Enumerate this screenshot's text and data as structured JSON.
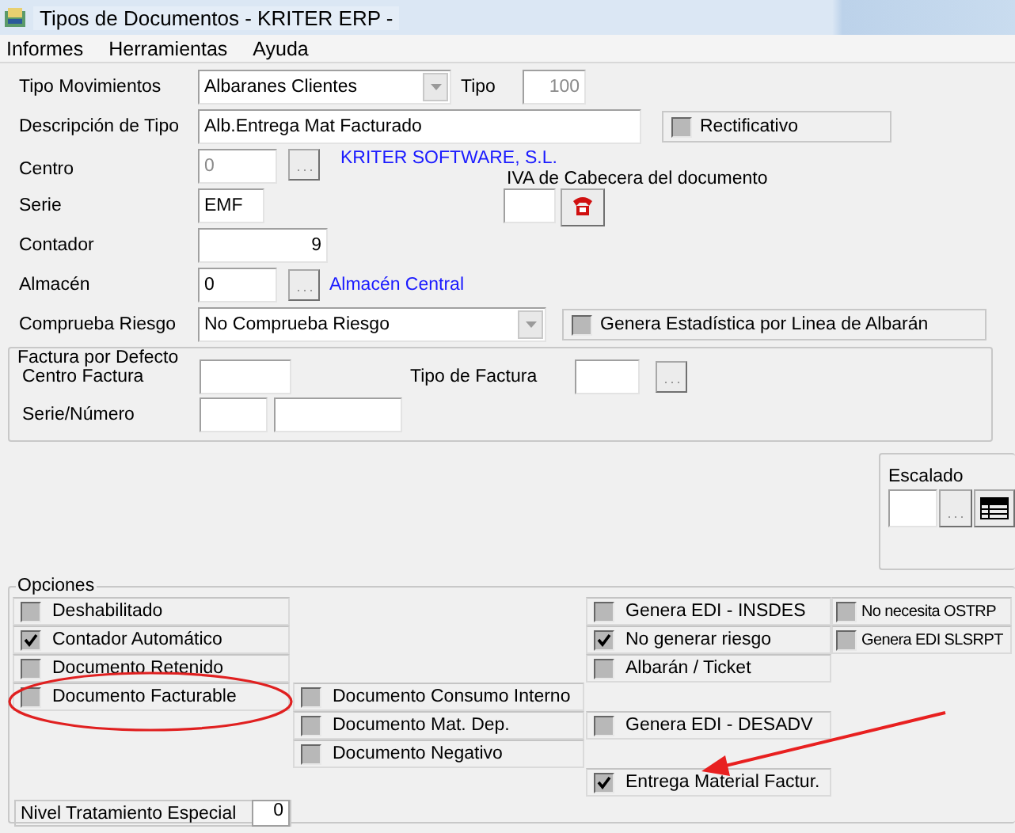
{
  "window": {
    "title": "Tipos de Documentos - KRITER ERP -"
  },
  "menu": [
    "Informes",
    "Herramientas",
    "Ayuda"
  ],
  "form": {
    "tipo_movimientos": {
      "label": "Tipo Movimientos",
      "value": "Albaranes Clientes"
    },
    "tipo": {
      "label": "Tipo",
      "value": "100",
      "disabled": true
    },
    "descripcion": {
      "label": "Descripción de Tipo",
      "value": "Alb.Entrega Mat Facturado"
    },
    "rectificativo": {
      "label": "Rectificativo",
      "checked": false
    },
    "centro": {
      "label": "Centro",
      "value": "0",
      "disabled": true,
      "name": "KRITER SOFTWARE, S.L."
    },
    "iva": {
      "label": "IVA de Cabecera del documento"
    },
    "serie": {
      "label": "Serie",
      "value": "EMF"
    },
    "contador": {
      "label": "Contador",
      "value": "9"
    },
    "almacen": {
      "label": "Almacén",
      "value": "0",
      "disabled": false,
      "name": "Almacén Central"
    },
    "comprueba_riesgo": {
      "label": "Comprueba Riesgo",
      "value": "No Comprueba Riesgo"
    },
    "genera_estadistica": {
      "label": "Genera Estadística por Linea de Albarán",
      "checked": false
    }
  },
  "factura_por_defecto": {
    "title": "Factura por Defecto",
    "centro_factura": {
      "label": "Centro Factura"
    },
    "tipo_de_factura": {
      "label": "Tipo de Factura"
    },
    "serie_numero": {
      "label": "Serie/Número"
    }
  },
  "escalado": {
    "title": "Escalado"
  },
  "opciones": {
    "title": "Opciones",
    "items": [
      {
        "label": "Deshabilitado",
        "checked": false
      },
      {
        "label": "Contador Automático",
        "checked": true
      },
      {
        "label": "Documento Retenido",
        "checked": false
      },
      {
        "label": "Documento Facturable",
        "checked": false
      },
      {
        "label": "Documento Consumo Interno",
        "checked": false
      },
      {
        "label": "Documento Mat. Dep.",
        "checked": false
      },
      {
        "label": "Documento Negativo",
        "checked": false
      },
      {
        "label": "Genera EDI - INSDES",
        "checked": false
      },
      {
        "label": "No generar riesgo",
        "checked": true
      },
      {
        "label": "Albarán / Ticket",
        "checked": false
      },
      {
        "label": "Genera EDI - DESADV",
        "checked": false
      },
      {
        "label": "Entrega Material Factur.",
        "checked": true
      },
      {
        "label": "No necesita OSTRP",
        "checked": false
      },
      {
        "label": "Genera EDI SLSRPT",
        "checked": false
      }
    ],
    "nivel": {
      "label": "Nivel Tratamiento Especial",
      "value": "0"
    }
  }
}
